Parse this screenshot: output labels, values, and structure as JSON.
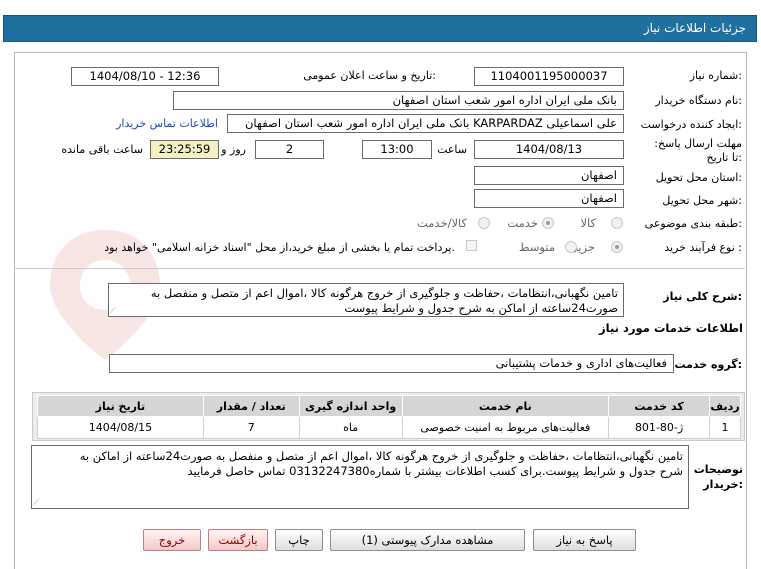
{
  "header": {
    "title": "جزئیات اطلاعات نیاز"
  },
  "fields": {
    "need_number": {
      "label": "شماره نیاز:",
      "value": "1104001195000037"
    },
    "announce": {
      "label": "تاریخ و ساعت اعلان عمومی:",
      "value": "1404/08/10 - 12:36"
    },
    "buyer": {
      "label": "نام دستگاه خریدار:",
      "value": "بانک ملی ایران اداره امور شعب استان اصفهان"
    },
    "creator": {
      "label": "ایجاد کننده درخواست:",
      "value": "علی اسماعیلی KARPARDAZ بانک ملی ایران اداره امور شعب استان اصفهان",
      "contact_link": "اطلاعات تماس خریدار"
    },
    "deadline": {
      "label": "مهلت ارسال پاسخ: تا تاریخ:",
      "date": "1404/08/13",
      "time_label": "ساعت",
      "time": "13:00",
      "days": "2",
      "days_label": "روز و",
      "remaining": "23:25:59",
      "remaining_label": "ساعت باقی مانده"
    },
    "province": {
      "label": "استان محل تحویل:",
      "value": "اصفهان"
    },
    "city": {
      "label": "شهر محل تحویل:",
      "value": "اصفهان"
    },
    "category": {
      "label": "طبقه بندی موضوعی:",
      "options": [
        "کالا",
        "خدمت",
        "کالا/خدمت"
      ],
      "selected": "خدمت"
    },
    "process": {
      "label": "نوع فرآیند خرید :",
      "options": [
        "جزیی",
        "متوسط"
      ],
      "selected": "جزیی",
      "payment_note": "پرداخت تمام یا بخشی از مبلغ خرید،از محل \"اسناد خزانه اسلامی\" خواهد بود."
    }
  },
  "summary": {
    "label": "شرح کلی نیاز:",
    "line1": "تامین نگهبانی،انتظامات ،حفاظت و جلوگیری از خروج هرگونه کالا ،اموال اعم از متصل و منفصل به",
    "line2": "صورت24ساعته از اماکن به شرح جدول و شرایط پیوست"
  },
  "services_title": "اطلاعات خدمات مورد نیاز",
  "service_group": {
    "label": "گروه خدمت:",
    "value": "فعالیت‌های اداری و خدمات پشتیبانی"
  },
  "table": {
    "headers": [
      "ردیف",
      "کد خدمت",
      "نام خدمت",
      "واحد اندازه گیری",
      "تعداد / مقدار",
      "تاریخ نیاز"
    ],
    "rows": [
      [
        "1",
        "ژ-80-801",
        "فعالیت‌های مربوط به امنیت خصوصی",
        "ماه",
        "7",
        "1404/08/15"
      ]
    ]
  },
  "buyer_notes": {
    "label": "توضیحات خریدار:",
    "line1": "تامین نگهبانی،انتظامات ،حفاظت و جلوگیری از خروج هرگونه کالا ،اموال اعم از متصل و منفصل به صورت24ساعته از اماکن به",
    "line2": "شرح جدول و شرایط پیوست.برای کسب اطلاعات بیشتر با شماره03132247380 تماس حاصل فرمایید"
  },
  "buttons": {
    "reply": "پاسخ به نیاز",
    "attachments": "مشاهده مدارک پیوستی (1)",
    "print": "چاپ",
    "back": "بازگشت",
    "exit": "خروج"
  },
  "watermark": "AriaTender.neT"
}
